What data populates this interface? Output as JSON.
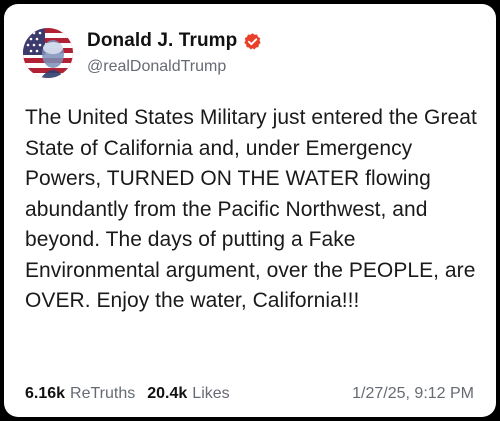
{
  "post": {
    "author": {
      "display_name": "Donald J. Trump",
      "handle": "@realDonaldTrump",
      "avatar_icon": "flag-portrait-avatar",
      "verified_icon": "verified-badge-icon",
      "verified_color": "#e8402a"
    },
    "body": "The United States Military just entered the Great State of California and, under Emergency Powers, TURNED ON THE WATER flowing abundantly from the Pacific Northwest, and beyond. The days of putting a Fake Environmental argument, over the PEOPLE, are OVER. Enjoy the water, California!!!",
    "stats": {
      "retruths_count": "6.16k",
      "retruths_label": "ReTruths",
      "likes_count": "20.4k",
      "likes_label": "Likes"
    },
    "timestamp": "1/27/25, 9:12 PM"
  }
}
